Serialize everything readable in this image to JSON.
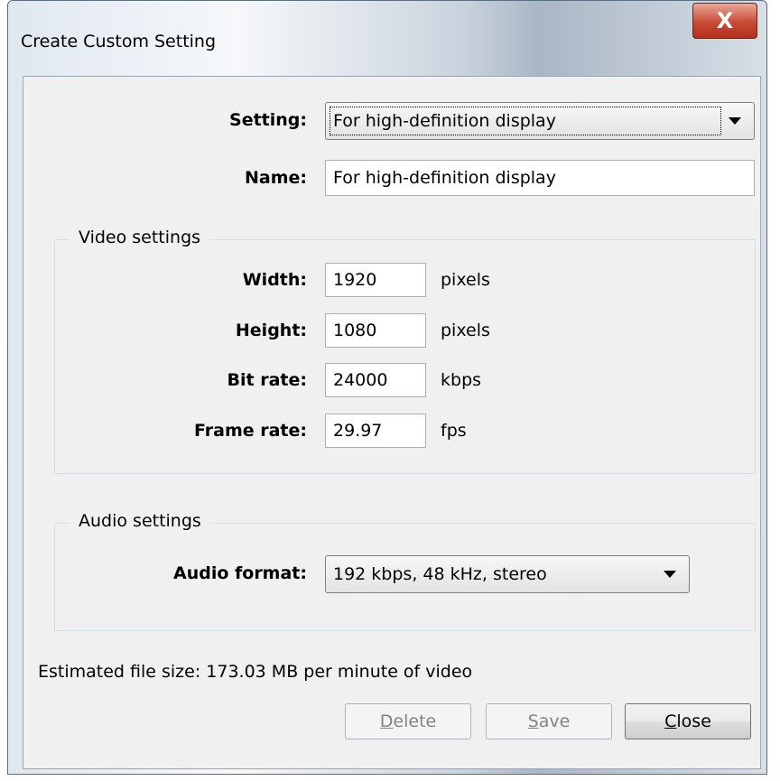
{
  "window": {
    "title": "Create Custom Setting",
    "close_glyph": "X"
  },
  "setting": {
    "label": "Setting:",
    "value": "For high-definition display"
  },
  "name": {
    "label": "Name:",
    "value": "For high-definition display"
  },
  "video": {
    "group_label": "Video settings",
    "fields": [
      {
        "label": "Width:",
        "value": "1920",
        "unit": "pixels"
      },
      {
        "label": "Height:",
        "value": "1080",
        "unit": "pixels"
      },
      {
        "label": "Bit rate:",
        "value": "24000",
        "unit": "kbps"
      },
      {
        "label": "Frame rate:",
        "value": "29.97",
        "unit": "fps"
      }
    ]
  },
  "audio": {
    "group_label": "Audio settings",
    "format_label": "Audio format:",
    "format_value": "192 kbps, 48 kHz, stereo"
  },
  "estimate": "Estimated file size: 173.03 MB per minute of video",
  "buttons": {
    "delete": {
      "first": "D",
      "rest": "elete"
    },
    "save": {
      "first": "S",
      "rest": "ave"
    },
    "close": {
      "first": "C",
      "rest": "lose"
    }
  }
}
